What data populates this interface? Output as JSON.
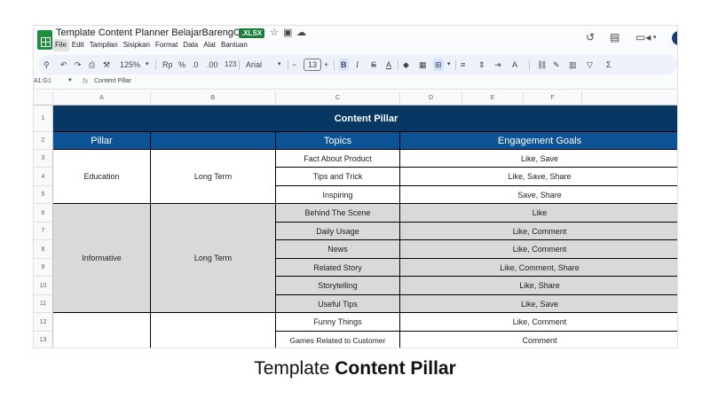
{
  "app": {
    "doc_title": "Template Content Planner BelajarBarengOdan",
    "file_badge": ".XLSX",
    "menu": [
      "File",
      "Edit",
      "Tampilan",
      "Sisipkan",
      "Format",
      "Data",
      "Alat",
      "Bantuan"
    ],
    "title_icons": [
      "star-icon",
      "move-to-folder-icon",
      "cloud-status-icon"
    ],
    "header_icons": [
      "version-history-icon",
      "comments-icon",
      "meet-icon"
    ]
  },
  "toolbar": {
    "search": "⚲",
    "undo": "↶",
    "redo": "↷",
    "print": "⎙",
    "paint_format": "⚒",
    "zoom": "125%",
    "currency": "Rp",
    "percent": "%",
    "decrease_decimal": ".0",
    "increase_decimal": ".00",
    "number_format": "123",
    "font": "Arial",
    "font_decrease": "−",
    "font_size": "13",
    "font_increase": "+",
    "bold": "B",
    "italic": "I",
    "strikethrough": "S",
    "text_color": "A",
    "fill_color": "◆",
    "borders": "▦",
    "merge": "⊞",
    "h_align": "≡",
    "v_align": "⇕",
    "wrap": "⇥",
    "rotate": "A",
    "link": "⛓",
    "comment": "✎",
    "chart": "▥",
    "filter": "▽",
    "functions": "Σ"
  },
  "formula_bar": {
    "name_box": "A1:G1",
    "fx": "fx",
    "content": "Content Pillar"
  },
  "grid": {
    "columns": [
      "A",
      "B",
      "C",
      "D",
      "E",
      "F"
    ],
    "rows": [
      "1",
      "2",
      "3",
      "4",
      "5",
      "6",
      "7",
      "8",
      "9",
      "10",
      "11",
      "12",
      "13"
    ],
    "title": "Content Pillar",
    "headers": {
      "pillar": "Pillar",
      "topics": "Topics",
      "engagement": "Engagement Goals"
    },
    "groups": [
      {
        "pillar": "Education",
        "term": "Long Term"
      },
      {
        "pillar": "Informative",
        "term": "Long Term"
      }
    ],
    "records": [
      {
        "topic": "Fact About Product",
        "goal": "Like, Save"
      },
      {
        "topic": "Tips and Trick",
        "goal": "Like, Save, Share"
      },
      {
        "topic": "Inspiring",
        "goal": "Save, Share"
      },
      {
        "topic": "Behind The Scene",
        "goal": "Like"
      },
      {
        "topic": "Daily Usage",
        "goal": "Like, Comment"
      },
      {
        "topic": "News",
        "goal": "Like, Comment"
      },
      {
        "topic": "Related Story",
        "goal": "Like, Comment, Share"
      },
      {
        "topic": "Storytelling",
        "goal": "Like, Share"
      },
      {
        "topic": "Useful Tips",
        "goal": "Like, Save"
      },
      {
        "topic": "Funny Things",
        "goal": "Like, Comment"
      },
      {
        "topic": "Games Related to Customer",
        "goal": "Comment"
      }
    ]
  },
  "colors": {
    "title_fill": "#073763",
    "header_fill": "#0b5394",
    "grey_fill": "#d9d9d9",
    "xlsx_badge": "#188038",
    "sheets_green": "#1e8e3e"
  },
  "caption": {
    "prefix": "Template",
    "bold": "Content Pillar"
  }
}
